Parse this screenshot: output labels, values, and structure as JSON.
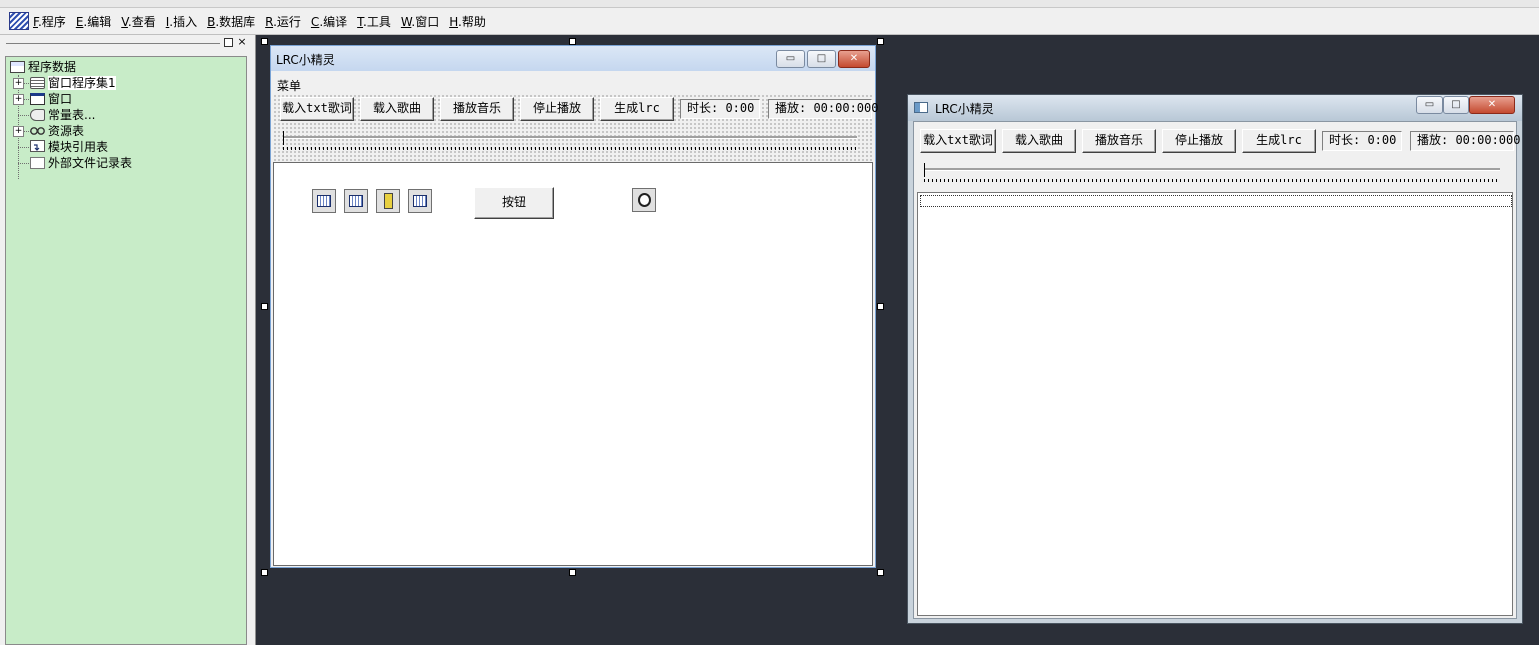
{
  "menubar": {
    "items": [
      {
        "key": "F",
        "label": ".程序"
      },
      {
        "key": "E",
        "label": ".编辑"
      },
      {
        "key": "V",
        "label": ".查看"
      },
      {
        "key": "I",
        "label": ".插入"
      },
      {
        "key": "B",
        "label": ".数据库"
      },
      {
        "key": "R",
        "label": ".运行"
      },
      {
        "key": "C",
        "label": ".编译"
      },
      {
        "key": "T",
        "label": ".工具"
      },
      {
        "key": "W",
        "label": ".窗口"
      },
      {
        "key": "H",
        "label": ".帮助"
      }
    ]
  },
  "panel": {
    "close_glyph": "×"
  },
  "tree": {
    "root": "程序数据",
    "items": [
      {
        "label": "窗口程序集1",
        "expand": "+",
        "icon": "stack-icon"
      },
      {
        "label": "窗口",
        "expand": "+",
        "icon": "window-icon"
      },
      {
        "label": "常量表...",
        "expand": "",
        "icon": "constant-icon"
      },
      {
        "label": "资源表",
        "expand": "+",
        "icon": "resource-icon"
      },
      {
        "label": "模块引用表",
        "expand": "",
        "icon": "module-icon"
      },
      {
        "label": "外部文件记录表",
        "expand": "",
        "icon": "file-icon"
      }
    ]
  },
  "form": {
    "title": "LRC小精灵",
    "menu": "菜单",
    "buttons": {
      "load_lyrics": "载入txt歌词",
      "load_song": "载入歌曲",
      "play": "播放音乐",
      "stop": "停止播放",
      "generate": "生成lrc"
    },
    "duration": "时长: 0:00",
    "playback": "播放: 00:00:000",
    "client_button": "按钮",
    "caption": {
      "min": "▭",
      "max": "□",
      "close": "✕"
    }
  },
  "preview": {
    "title": "LRC小精灵",
    "buttons": {
      "load_lyrics": "载入txt歌词",
      "load_song": "载入歌曲",
      "play": "播放音乐",
      "stop": "停止播放",
      "generate": "生成lrc"
    },
    "duration": "时长: 0:00",
    "playback": "播放: 00:00:000",
    "caption": {
      "min": "▭",
      "max": "□",
      "close": "✕"
    }
  }
}
